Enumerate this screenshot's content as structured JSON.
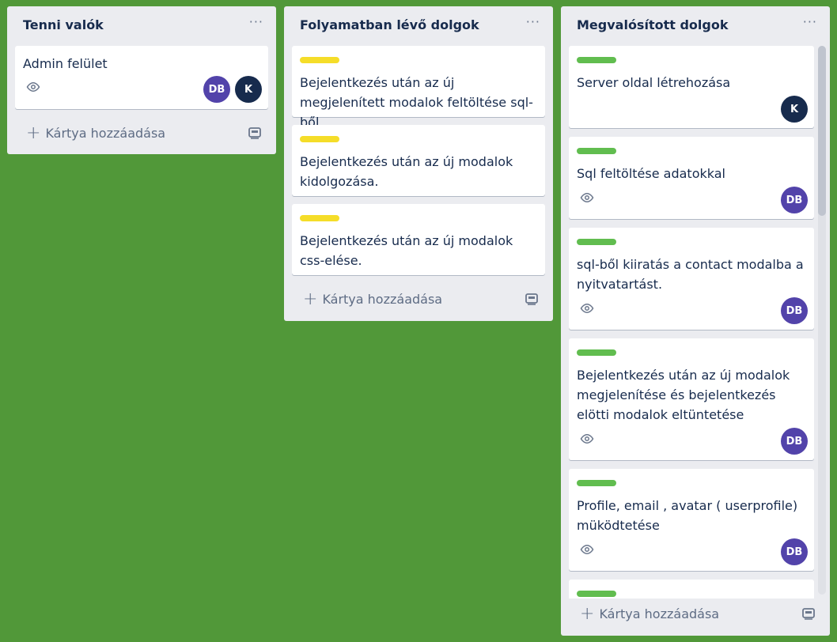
{
  "colors": {
    "board_bg": "#519839",
    "label_yellow": "#f5dd29",
    "label_green": "#61bd4f",
    "avatar_db": "#5243aa",
    "avatar_k": "#172b4d"
  },
  "lists": [
    {
      "title": "Tenni valók",
      "menu": "···",
      "add_card": "Kártya hozzáadása",
      "cards": [
        {
          "text": "Admin felület",
          "eye": "eye-icon",
          "avatars": [
            "DB",
            "K"
          ]
        }
      ]
    },
    {
      "title": "Folyamatban lévő dolgok",
      "menu": "···",
      "add_card": "Kártya hozzáadása",
      "cards": [
        {
          "label": "yellow",
          "text": "Bejelentkezés után az új megjelenített modalok feltöltése sql-ből."
        },
        {
          "label": "yellow",
          "text": "Bejelentkezés után az új modalok kidolgozása."
        },
        {
          "label": "yellow",
          "text": "Bejelentkezés után az új modalok css-elése."
        }
      ]
    },
    {
      "title": "Megvalósított dolgok",
      "menu": "···",
      "add_card": "Kártya hozzáadása",
      "cards": [
        {
          "label": "green",
          "text": "Server oldal létrehozása",
          "avatars": [
            "K"
          ]
        },
        {
          "label": "green",
          "text": "Sql feltöltése adatokkal",
          "eye": "eye-icon",
          "avatars": [
            "DB"
          ]
        },
        {
          "label": "green",
          "text": "sql-ből kiiratás a contact modalba a nyitvatartást.",
          "eye": "eye-icon",
          "avatars": [
            "DB"
          ]
        },
        {
          "label": "green",
          "text": "Bejelentkezés után az új modalok megjelenítése és bejelentkezés elötti modalok eltüntetése",
          "eye": "eye-icon",
          "avatars": [
            "DB"
          ]
        },
        {
          "label": "green",
          "text": "Profile, email , avatar ( userprofile) müködtetése",
          "eye": "eye-icon",
          "avatars": [
            "DB"
          ]
        },
        {
          "label": "green",
          "text": ""
        }
      ]
    }
  ],
  "icons": {
    "add": "plus-icon",
    "template": "card-template-icon",
    "watch": "eye-icon"
  }
}
